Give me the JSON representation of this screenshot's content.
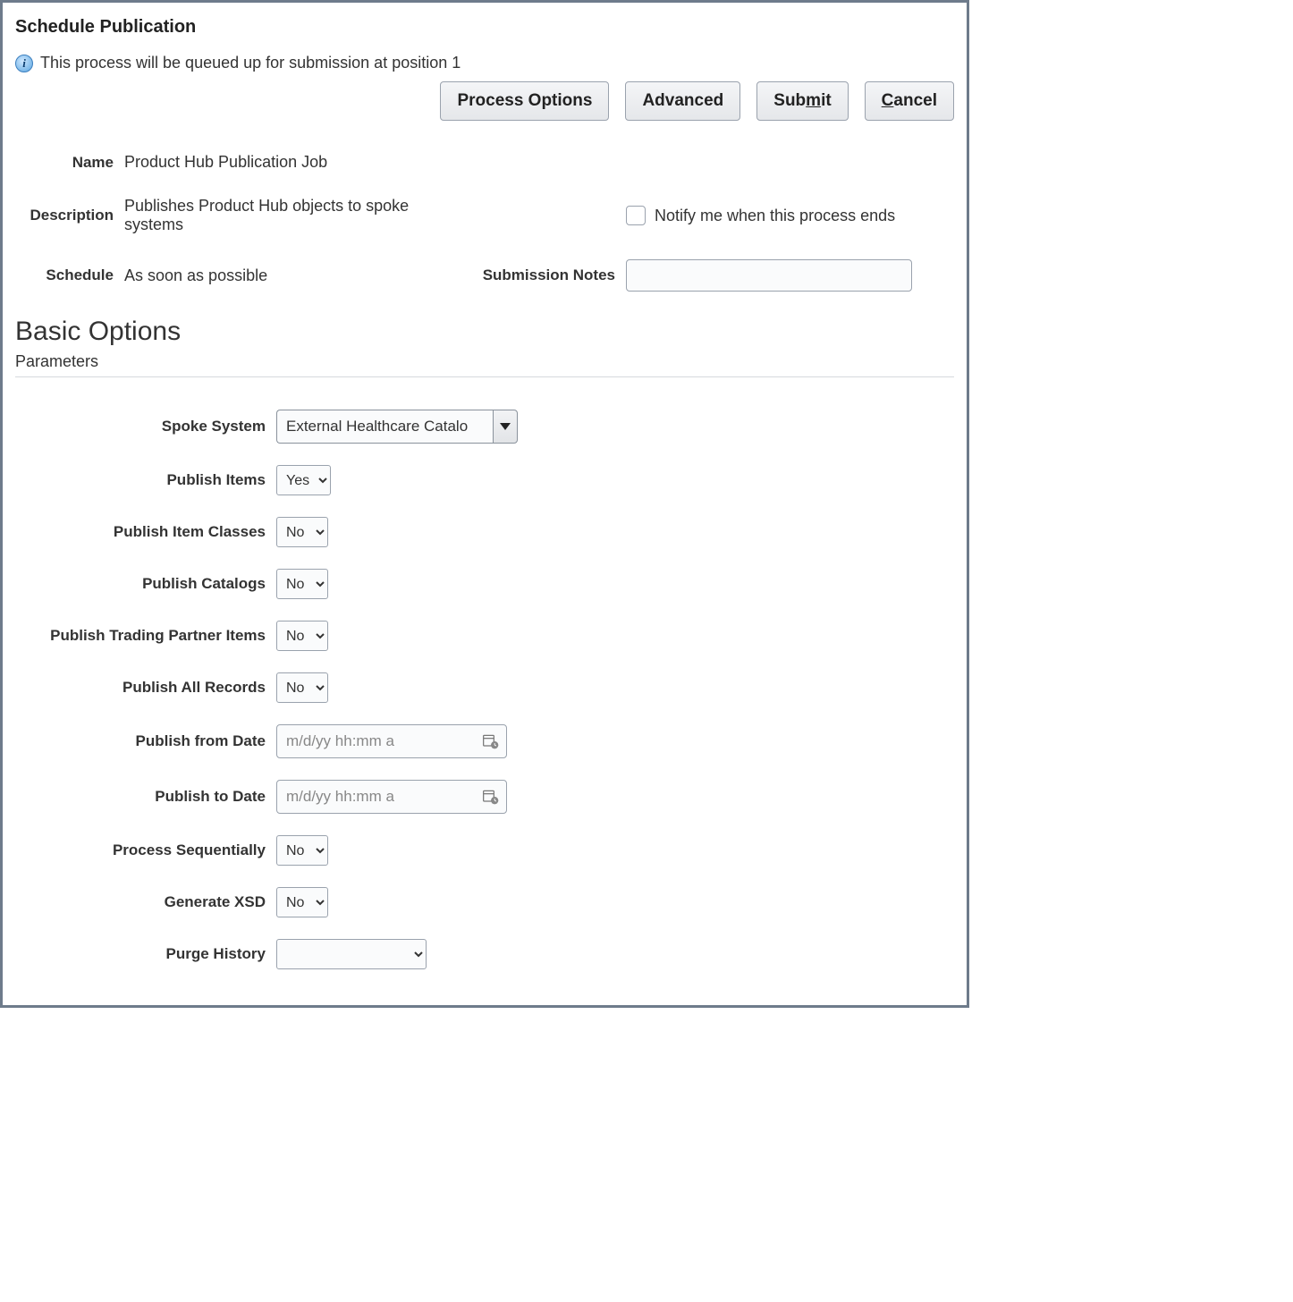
{
  "dialog": {
    "title": "Schedule Publication",
    "info": "This process will be queued up for submission at position 1"
  },
  "buttons": {
    "process_options": "Process Options",
    "advanced": "Advanced",
    "submit_pre": "Sub",
    "submit_ul": "m",
    "submit_post": "it",
    "cancel_ul": "C",
    "cancel_post": "ancel"
  },
  "meta": {
    "name_label": "Name",
    "name_value": "Product Hub Publication Job",
    "description_label": "Description",
    "description_value": "Publishes Product Hub objects to spoke systems",
    "schedule_label": "Schedule",
    "schedule_value": "As soon as possible",
    "notify_label": "Notify me when this process ends",
    "submission_notes_label": "Submission Notes",
    "submission_notes_value": ""
  },
  "section": {
    "basic_options": "Basic Options",
    "parameters": "Parameters"
  },
  "params": {
    "spoke_system_label": "Spoke System",
    "spoke_system_value": "External Healthcare Catalo",
    "publish_items_label": "Publish Items",
    "publish_items_value": "Yes",
    "publish_item_classes_label": "Publish Item Classes",
    "publish_item_classes_value": "No",
    "publish_catalogs_label": "Publish Catalogs",
    "publish_catalogs_value": "No",
    "publish_tpi_label": "Publish Trading Partner Items",
    "publish_tpi_value": "No",
    "publish_all_label": "Publish All Records",
    "publish_all_value": "No",
    "publish_from_label": "Publish from Date",
    "publish_from_placeholder": "m/d/yy hh:mm a",
    "publish_to_label": "Publish to Date",
    "publish_to_placeholder": "m/d/yy hh:mm a",
    "process_seq_label": "Process Sequentially",
    "process_seq_value": "No",
    "generate_xsd_label": "Generate XSD",
    "generate_xsd_value": "No",
    "purge_history_label": "Purge History",
    "purge_history_value": ""
  },
  "select_options": {
    "yes": "Yes",
    "no": "No"
  }
}
